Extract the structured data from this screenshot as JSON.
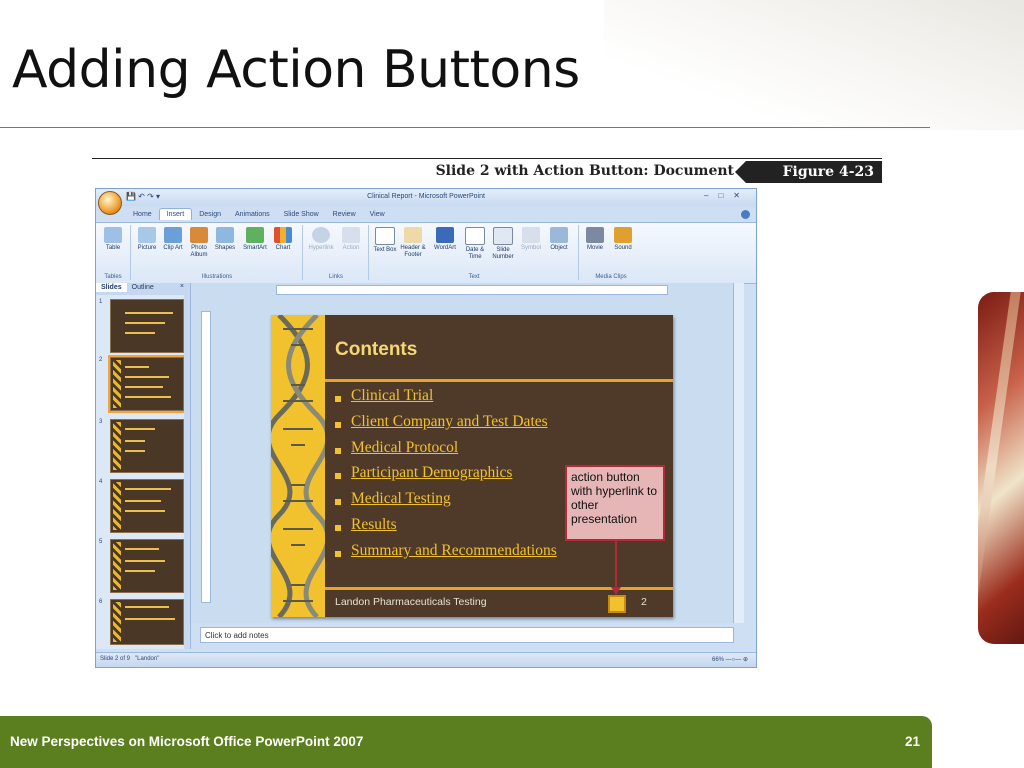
{
  "slide": {
    "title": "Adding Action Buttons",
    "footer_text": "New Perspectives on Microsoft Office PowerPoint 2007",
    "page_number": "21"
  },
  "figure": {
    "caption": "Slide 2 with Action Button: Document",
    "number": "Figure 4-23"
  },
  "ppt_window": {
    "title": "Clinical Report - Microsoft PowerPoint",
    "tabs": [
      "Home",
      "Insert",
      "Design",
      "Animations",
      "Slide Show",
      "Review",
      "View"
    ],
    "active_tab": "Insert",
    "ribbon_groups": {
      "tables": "Tables",
      "illustrations": "Illustrations",
      "links": "Links",
      "text": "Text",
      "media": "Media Clips"
    },
    "ribbon_buttons": {
      "table": "Table",
      "picture": "Picture",
      "clip_art": "Clip Art",
      "photo_album": "Photo Album",
      "shapes": "Shapes",
      "smartart": "SmartArt",
      "chart": "Chart",
      "hyperlink": "Hyperlink",
      "action": "Action",
      "text_box": "Text Box",
      "header_footer": "Header & Footer",
      "wordart": "WordArt",
      "date_time": "Date & Time",
      "slide_number": "Slide Number",
      "symbol": "Symbol",
      "object": "Object",
      "movie": "Movie",
      "sound": "Sound"
    },
    "pane_tabs": {
      "slides": "Slides",
      "outline": "Outline"
    },
    "thumb_numbers": [
      "1",
      "2",
      "3",
      "4",
      "5",
      "6"
    ],
    "notes_placeholder": "Click to add notes",
    "status": {
      "slide_of": "Slide 2 of 9",
      "theme": "\"Landon\"",
      "zoom": "66%"
    }
  },
  "slide_content": {
    "heading": "Contents",
    "bullets": [
      "Clinical Trial",
      "Client Company and Test Dates",
      "Medical Protocol",
      "Participant Demographics",
      "Medical Testing",
      "Results",
      "Summary and Recommendations"
    ],
    "footer": "Landon Pharmaceuticals Testing",
    "page_number": "2",
    "callout": "action button with hyperlink to other presentation"
  },
  "colors": {
    "footer_bar": "#5b7f1e",
    "slide_bg": "#4f3a2a",
    "accent_gold": "#f2c12e",
    "callout_border": "#b02a3a"
  }
}
